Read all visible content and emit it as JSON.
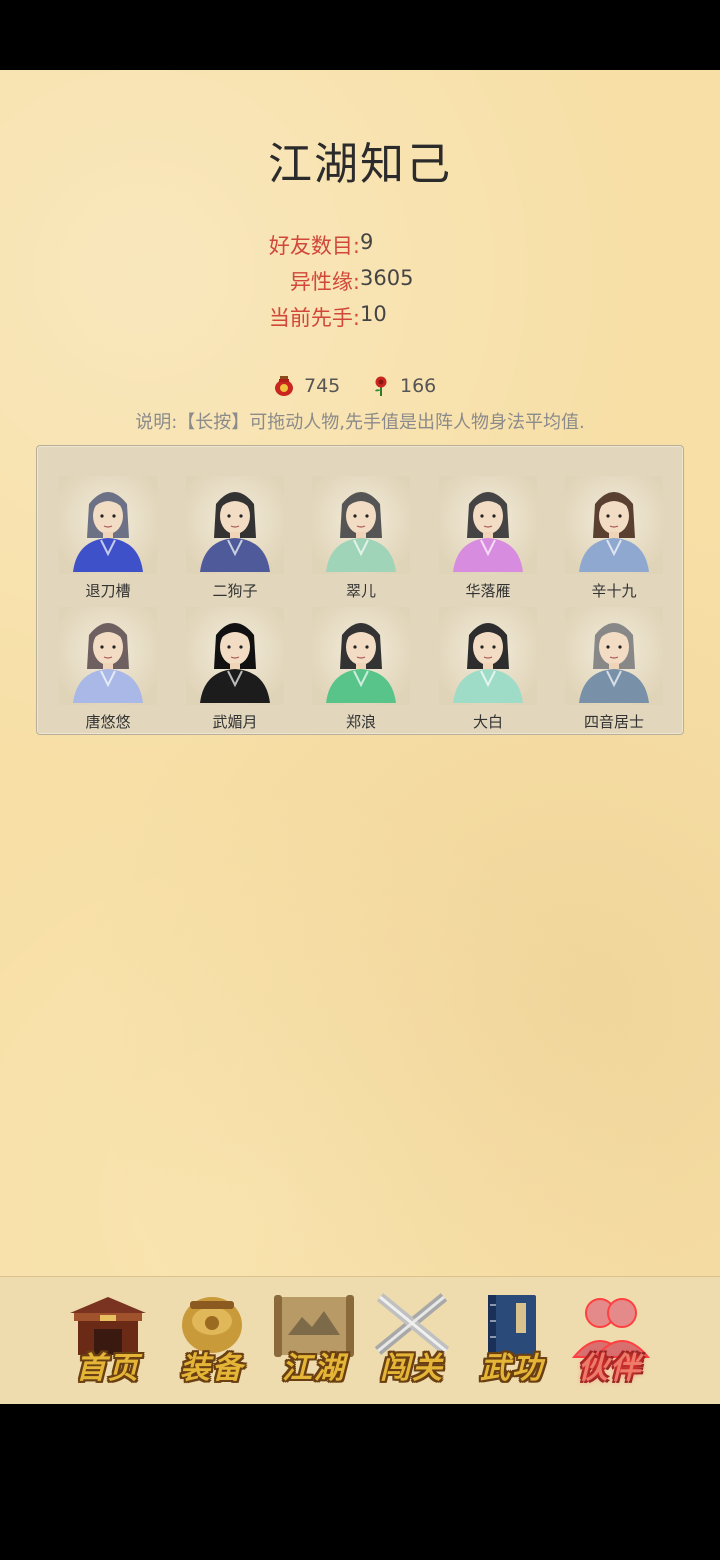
{
  "page": {
    "title": "江湖知己"
  },
  "stats": [
    {
      "label": "好友数目:",
      "value": "9"
    },
    {
      "label": "异性缘:",
      "value": "3605"
    },
    {
      "label": "当前先手:",
      "value": "10"
    }
  ],
  "resources": {
    "wine": {
      "icon": "wine-jar-icon",
      "value": "745"
    },
    "rose": {
      "icon": "rose-icon",
      "value": "166"
    }
  },
  "note": "说明:【长按】可拖动人物,先手值是出阵人物身法平均值.",
  "characters": [
    {
      "name": "退刀槽",
      "robe": "#3f51c8",
      "hair": "#6d7185"
    },
    {
      "name": "二狗子",
      "robe": "#4f5a9a",
      "hair": "#333333"
    },
    {
      "name": "翠儿",
      "robe": "#9fd4b8",
      "hair": "#555555"
    },
    {
      "name": "华落雁",
      "robe": "#d88ce0",
      "hair": "#444444"
    },
    {
      "name": "辛十九",
      "robe": "#8fa8d0",
      "hair": "#5a4030"
    },
    {
      "name": "唐悠悠",
      "robe": "#a9b8e6",
      "hair": "#6e6060"
    },
    {
      "name": "武媚月",
      "robe": "#1c1c1c",
      "hair": "#111111"
    },
    {
      "name": "郑浪",
      "robe": "#58c48a",
      "hair": "#333333"
    },
    {
      "name": "大白",
      "robe": "#9fdcc8",
      "hair": "#2d2d2d"
    },
    {
      "name": "四音居士",
      "robe": "#7890a8",
      "hair": "#888888"
    }
  ],
  "nav": [
    {
      "label": "首页",
      "icon": "home-building-icon",
      "active": false
    },
    {
      "label": "装备",
      "icon": "armor-icon",
      "active": false
    },
    {
      "label": "江湖",
      "icon": "scroll-map-icon",
      "active": false
    },
    {
      "label": "闯关",
      "icon": "crossed-swords-icon",
      "active": false
    },
    {
      "label": "武功",
      "icon": "book-icon",
      "active": false
    },
    {
      "label": "伙伴",
      "icon": "companions-icon",
      "active": true
    }
  ]
}
